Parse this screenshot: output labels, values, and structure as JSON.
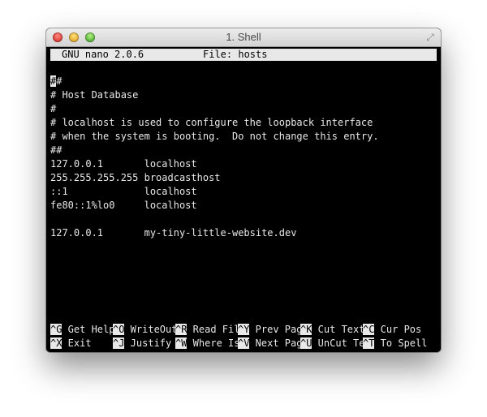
{
  "window": {
    "title": "1. Shell",
    "resize_icon": "resize-icon"
  },
  "nano": {
    "version": "GNU nano 2.0.6",
    "file_label": "File: hosts"
  },
  "editor": {
    "first_char": "#",
    "first_rest": "#",
    "lines": [
      "# Host Database",
      "#",
      "# localhost is used to configure the loopback interface",
      "# when the system is booting.  Do not change this entry.",
      "##",
      "127.0.0.1       localhost",
      "255.255.255.255 broadcasthost",
      "::1             localhost",
      "fe80::1%lo0     localhost",
      "",
      "127.0.0.1       my-tiny-little-website.dev"
    ]
  },
  "shortcuts": {
    "row1": [
      {
        "key": "^G",
        "label": " Get Help"
      },
      {
        "key": "^O",
        "label": " WriteOut"
      },
      {
        "key": "^R",
        "label": " Read Fil"
      },
      {
        "key": "^Y",
        "label": " Prev Pag"
      },
      {
        "key": "^K",
        "label": " Cut Text"
      },
      {
        "key": "^C",
        "label": " Cur Pos"
      }
    ],
    "row2": [
      {
        "key": "^X",
        "label": " Exit"
      },
      {
        "key": "^J",
        "label": " Justify"
      },
      {
        "key": "^W",
        "label": " Where Is"
      },
      {
        "key": "^V",
        "label": " Next Pag"
      },
      {
        "key": "^U",
        "label": " UnCut Te"
      },
      {
        "key": "^T",
        "label": " To Spell"
      }
    ]
  }
}
